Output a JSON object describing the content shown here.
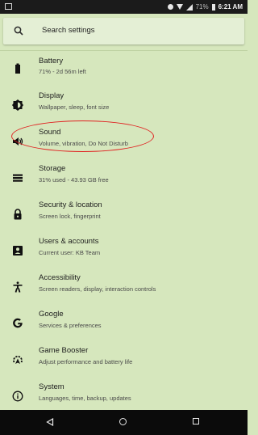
{
  "status_bar": {
    "battery_percent": "71%",
    "time": "6:21 AM"
  },
  "search": {
    "placeholder": "Search settings"
  },
  "settings": [
    {
      "title": "Battery",
      "subtitle": "71% - 2d 56m left",
      "icon": "battery-icon"
    },
    {
      "title": "Display",
      "subtitle": "Wallpaper, sleep, font size",
      "icon": "brightness-icon"
    },
    {
      "title": "Sound",
      "subtitle": "Volume, vibration, Do Not Disturb",
      "icon": "volume-icon"
    },
    {
      "title": "Storage",
      "subtitle": "31% used - 43.93 GB free",
      "icon": "storage-icon"
    },
    {
      "title": "Security & location",
      "subtitle": "Screen lock, fingerprint",
      "icon": "lock-icon"
    },
    {
      "title": "Users & accounts",
      "subtitle": "Current user: KB Team",
      "icon": "account-icon"
    },
    {
      "title": "Accessibility",
      "subtitle": "Screen readers, display, interaction controls",
      "icon": "accessibility-icon"
    },
    {
      "title": "Google",
      "subtitle": "Services & preferences",
      "icon": "google-icon"
    },
    {
      "title": "Game Booster",
      "subtitle": "Adjust performance and battery life",
      "icon": "game-booster-icon"
    },
    {
      "title": "System",
      "subtitle": "Languages, time, backup, updates",
      "icon": "info-icon"
    }
  ],
  "highlight_color": "#e02020",
  "background_color": "#d6e7bd"
}
